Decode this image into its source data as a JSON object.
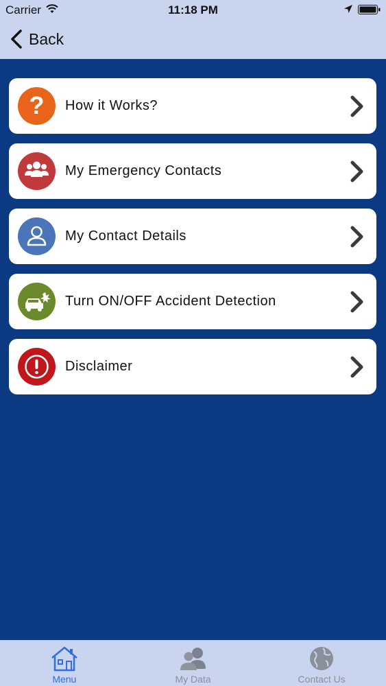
{
  "status_bar": {
    "carrier": "Carrier",
    "time": "11:18 PM"
  },
  "nav": {
    "back_label": "Back"
  },
  "menu": {
    "items": [
      {
        "label": "How it Works?",
        "icon": "question-icon",
        "color": "#e8641b"
      },
      {
        "label": "My Emergency Contacts",
        "icon": "group-contacts-icon",
        "color": "#c0393b"
      },
      {
        "label": "My Contact Details",
        "icon": "person-icon",
        "color": "#4a75b8"
      },
      {
        "label": "Turn ON/OFF Accident Detection",
        "icon": "car-crash-icon",
        "color": "#6b8a2c"
      },
      {
        "label": "Disclaimer",
        "icon": "alert-icon",
        "color": "#c0171c"
      }
    ]
  },
  "tabbar": {
    "tabs": [
      {
        "label": "Menu",
        "icon": "house-icon",
        "active": true
      },
      {
        "label": "My Data",
        "icon": "people-icon",
        "active": false
      },
      {
        "label": "Contact Us",
        "icon": "globe-icon",
        "active": false
      }
    ]
  },
  "colors": {
    "background": "#0b3a82",
    "bar": "#c9d4ef",
    "active_tab": "#2f6fe0",
    "inactive_tab": "#8a8f99"
  }
}
